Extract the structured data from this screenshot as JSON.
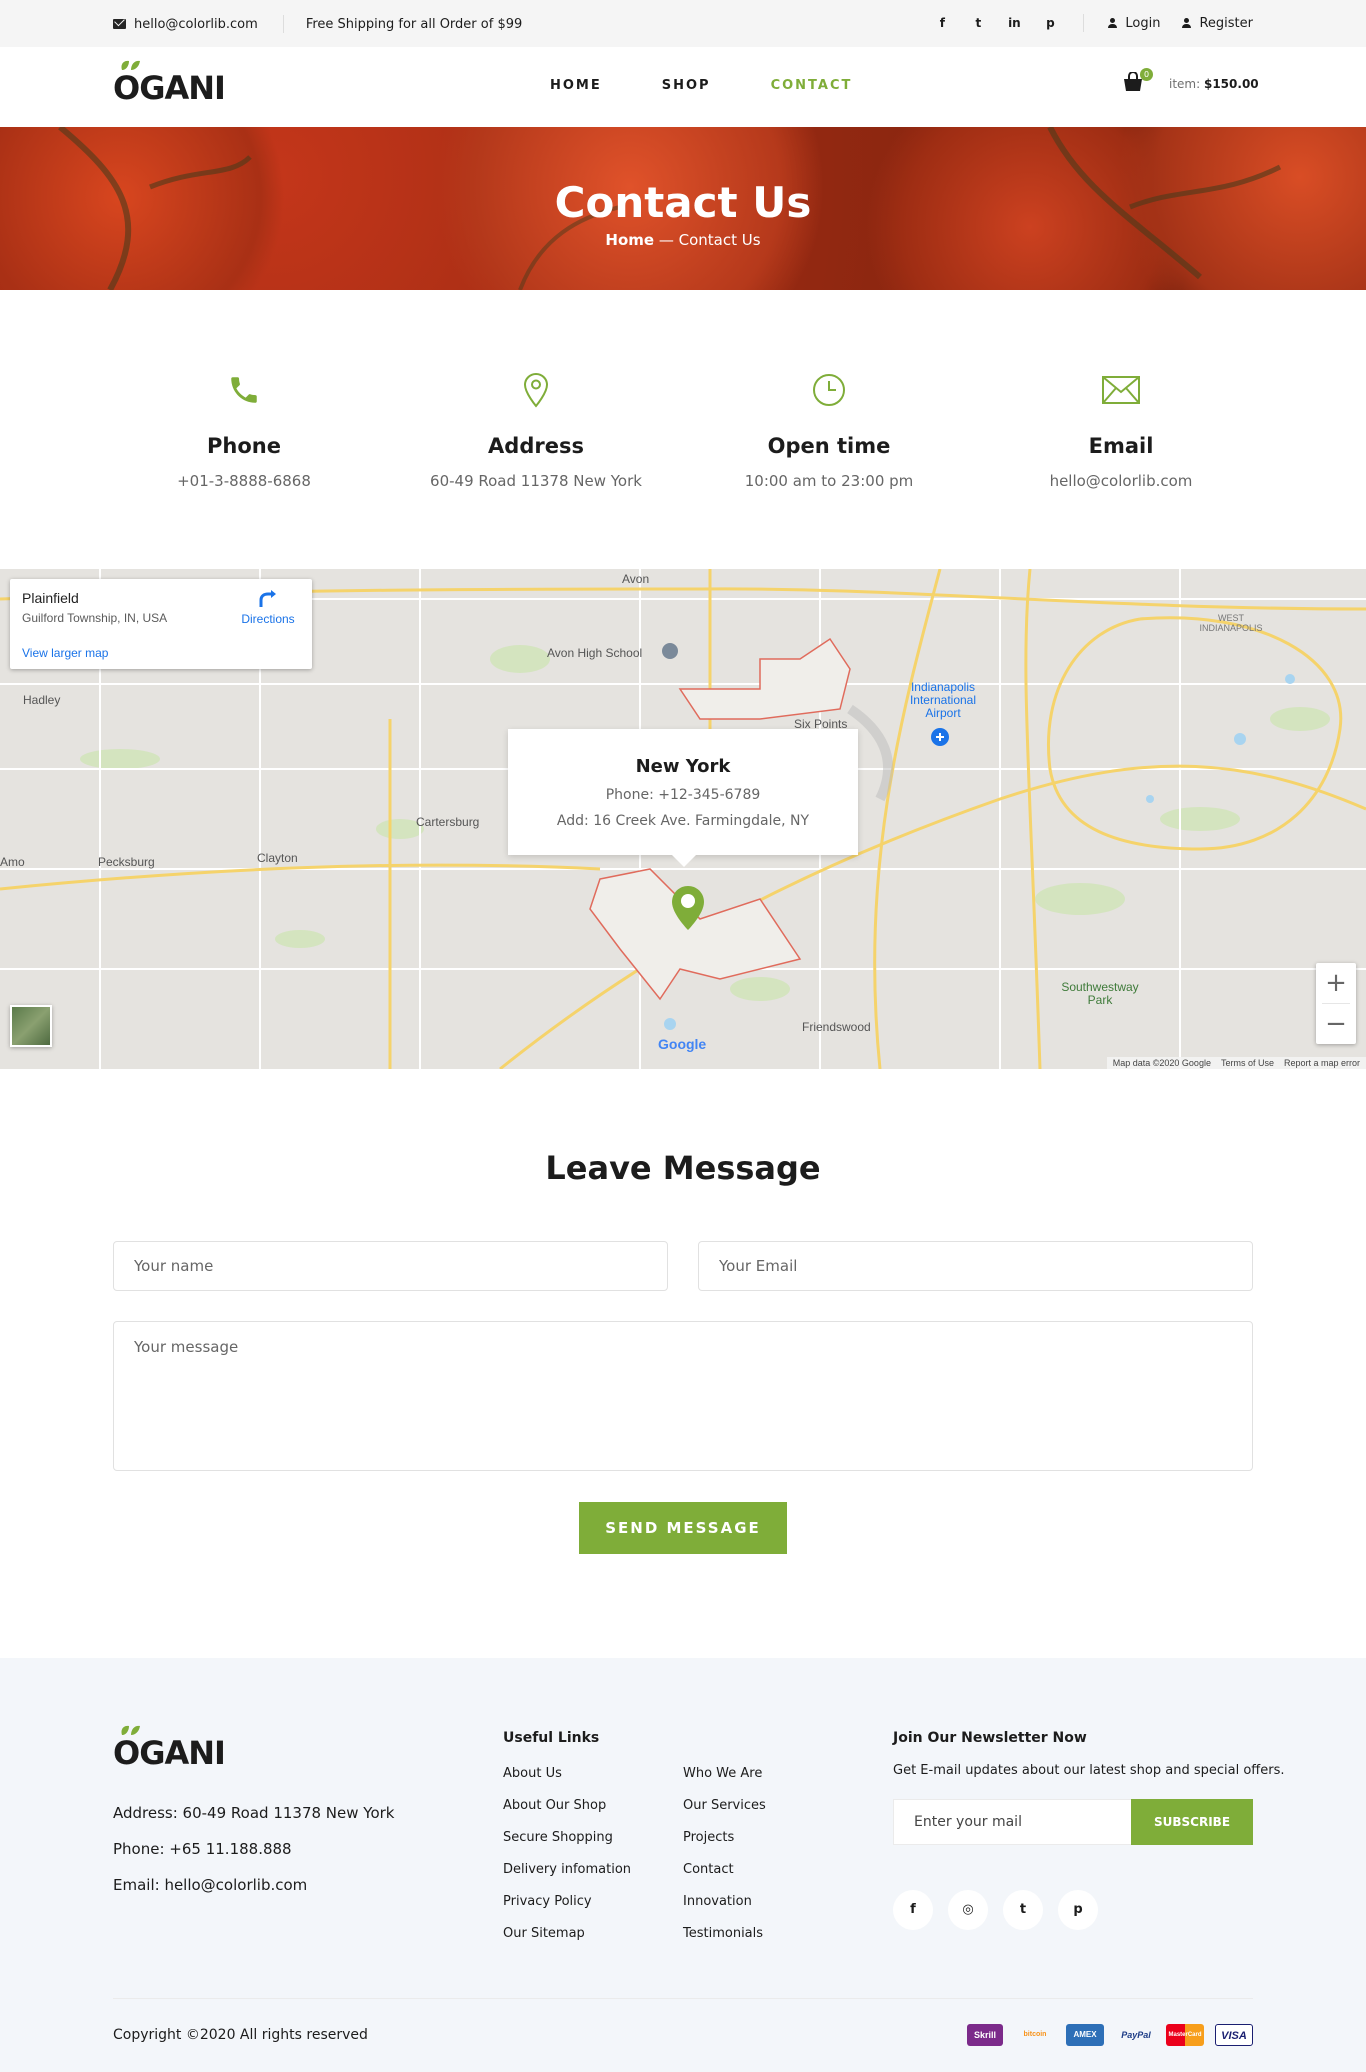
{
  "topbar": {
    "email": "hello@colorlib.com",
    "shipping": "Free Shipping for all Order of $99",
    "social": [
      "f",
      "t",
      "in",
      "p"
    ],
    "login": "Login",
    "register": "Register"
  },
  "header": {
    "logo": "OGANI",
    "nav": [
      "HOME",
      "SHOP",
      "CONTACT"
    ],
    "active_nav": "CONTACT",
    "cart_count": "0",
    "cart_label": "item:",
    "cart_total": "$150.00"
  },
  "hero": {
    "title": "Contact Us",
    "crumb_home": "Home",
    "crumb_sep": " — ",
    "crumb_current": "Contact Us"
  },
  "contact_info": [
    {
      "icon": "phone-icon",
      "title": "Phone",
      "value": "+01-3-8888-6868"
    },
    {
      "icon": "map-pin-icon",
      "title": "Address",
      "value": "60-49 Road 11378 New York"
    },
    {
      "icon": "clock-icon",
      "title": "Open time",
      "value": "10:00 am to 23:00 pm"
    },
    {
      "icon": "envelope-icon",
      "title": "Email",
      "value": "hello@colorlib.com"
    }
  ],
  "map": {
    "place_title": "Plainfield",
    "place_subtitle": "Guilford Township, IN, USA",
    "directions": "Directions",
    "larger_map": "View larger map",
    "popup_title": "New York",
    "popup_phone": "Phone: +12-345-6789",
    "popup_address": "Add: 16 Creek Ave. Farmingdale, NY",
    "labels": [
      "Avon",
      "Avon High School",
      "Hadley",
      "Indianapolis International Airport",
      "Six Points",
      "WEST INDIANAPOLIS",
      "Cartersburg",
      "Clayton",
      "Pecksburg",
      "Amo",
      "Southwestway Park",
      "Friendswood"
    ],
    "google": "Google",
    "attribution": [
      "Map data ©2020 Google",
      "Terms of Use",
      "Report a map error"
    ],
    "zoom_in": "+",
    "zoom_out": "−"
  },
  "message": {
    "title": "Leave Message",
    "name_placeholder": "Your name",
    "email_placeholder": "Your Email",
    "message_placeholder": "Your message",
    "send": "SEND MESSAGE"
  },
  "footer": {
    "logo": "OGANI",
    "address": "Address: 60-49 Road 11378 New York",
    "phone": "Phone: +65 11.188.888",
    "email": "Email: hello@colorlib.com",
    "useful_links_title": "Useful Links",
    "links_col1": [
      "About Us",
      "About Our Shop",
      "Secure Shopping",
      "Delivery infomation",
      "Privacy Policy",
      "Our Sitemap"
    ],
    "links_col2": [
      "Who We Are",
      "Our Services",
      "Projects",
      "Contact",
      "Innovation",
      "Testimonials"
    ],
    "newsletter_title": "Join Our Newsletter Now",
    "newsletter_desc": "Get E-mail updates about our latest shop and special offers.",
    "newsletter_placeholder": "Enter your mail",
    "subscribe": "SUBSCRIBE",
    "social": [
      "f",
      "◎",
      "t",
      "p"
    ],
    "copyright": "Copyright ©2020 All rights reserved",
    "payments": [
      "Skrill",
      "bitcoin",
      "AMEX",
      "PayPal",
      "MasterCard",
      "VISA"
    ]
  },
  "colors": {
    "accent": "#7fad39",
    "text": "#1c1c1c",
    "footer_bg": "#f3f6fa"
  }
}
